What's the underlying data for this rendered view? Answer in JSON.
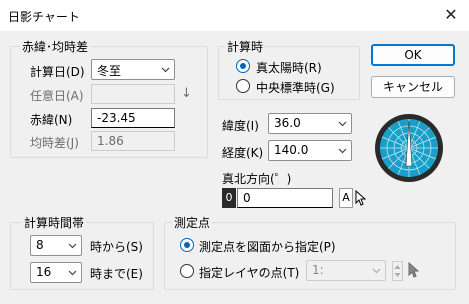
{
  "window": {
    "title": "日影チャート",
    "close_glyph": "✕"
  },
  "group_declination": {
    "legend": "赤緯･均時差",
    "calc_day_label": "計算日(D)",
    "calc_day_value": "冬至",
    "custom_day_label": "任意日(A)",
    "custom_day_value": "",
    "down_arrow_glyph": "↓",
    "declination_label": "赤緯(N)",
    "declination_value": "-23.45",
    "eq_time_label": "均時差(J)",
    "eq_time_value": "1.86"
  },
  "group_time": {
    "legend": "計算時",
    "radio_solar": "真太陽時(R)",
    "radio_standard": "中央標準時(G)",
    "selected": "solar"
  },
  "buttons": {
    "ok": "OK",
    "cancel": "キャンセル"
  },
  "location": {
    "latitude_label": "緯度(I)",
    "latitude_value": "36.0",
    "longitude_label": "経度(K)",
    "longitude_value": "140.0",
    "north_label": "真北方向(゜)",
    "north_value": "0",
    "north_prefix": "0",
    "north_btn_a": "A",
    "north_btn_pick_icon": "cursor-pick-icon"
  },
  "compass": {
    "icon": "compass-icon"
  },
  "group_range": {
    "legend": "計算時間帯",
    "from_value": "8",
    "from_label": "時から(S)",
    "to_value": "16",
    "to_label": "時まで(E)"
  },
  "group_point": {
    "legend": "測定点",
    "radio_from_drawing": "測定点を図面から指定(P)",
    "radio_layer": "指定レイヤの点(T)",
    "layer_value": "1:",
    "selected": "from_drawing"
  },
  "colors": {
    "accent": "#0078d4",
    "compass_bg": "#1aa0c8",
    "compass_dark": "#2a2a2a"
  }
}
